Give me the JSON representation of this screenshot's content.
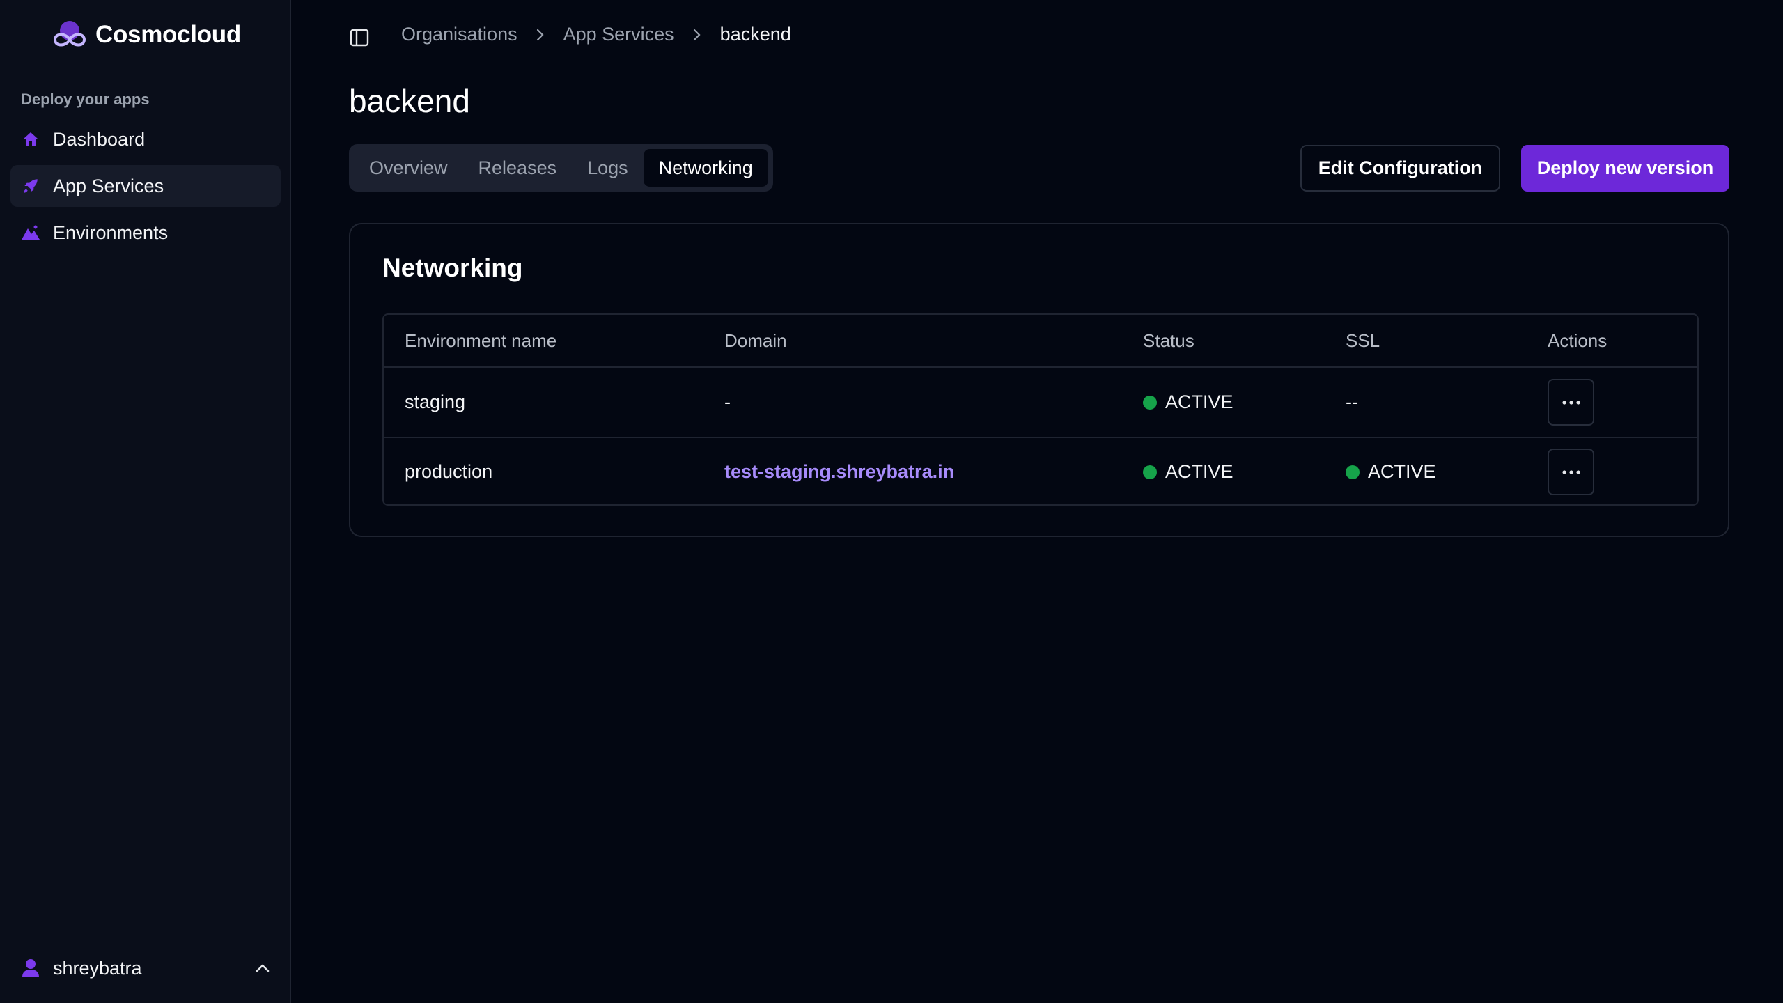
{
  "brand": {
    "name": "Cosmocloud",
    "accent": "#6d28d9"
  },
  "sidebar": {
    "section_label": "Deploy your apps",
    "items": [
      {
        "label": "Dashboard",
        "icon": "home-icon",
        "active": false
      },
      {
        "label": "App Services",
        "icon": "rocket-icon",
        "active": true
      },
      {
        "label": "Environments",
        "icon": "mountain-icon",
        "active": false
      }
    ],
    "user": {
      "name": "shreybatra",
      "icon": "user-icon"
    }
  },
  "header": {
    "breadcrumb": [
      "Organisations",
      "App Services",
      "backend"
    ],
    "title": "backend"
  },
  "tabs": [
    {
      "label": "Overview",
      "active": false
    },
    {
      "label": "Releases",
      "active": false
    },
    {
      "label": "Logs",
      "active": false
    },
    {
      "label": "Networking",
      "active": true
    }
  ],
  "actions": {
    "edit_label": "Edit Configuration",
    "deploy_label": "Deploy new version"
  },
  "networking": {
    "title": "Networking",
    "columns": [
      "Environment name",
      "Domain",
      "Status",
      "SSL",
      "Actions"
    ],
    "rows": [
      {
        "environment": "staging",
        "domain": "-",
        "domain_is_link": false,
        "status": "ACTIVE",
        "ssl": "--",
        "ssl_active": false
      },
      {
        "environment": "production",
        "domain": "test-staging.shreybatra.in",
        "domain_is_link": true,
        "status": "ACTIVE",
        "ssl": "ACTIVE",
        "ssl_active": true
      }
    ],
    "status_color": "#16a34a"
  }
}
